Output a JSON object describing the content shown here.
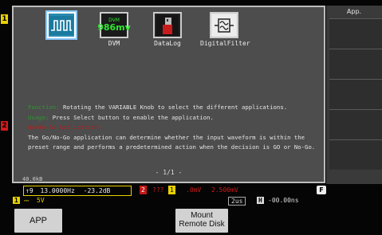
{
  "menu": {
    "title": "App."
  },
  "apps": [
    {
      "id": "go-nogo",
      "label": ""
    },
    {
      "id": "dvm",
      "label": "DVM",
      "screen_top": "DVM",
      "screen_value": "986mv"
    },
    {
      "id": "datalog",
      "label": "DataLog"
    },
    {
      "id": "digitalfilter",
      "label": "DigitalFilter"
    }
  ],
  "description": {
    "line1_label": "Function:",
    "line1_text": "Rotating the VARIABLE Knob to select the different applications.",
    "line2_label": "Usage:",
    "line2_text": "Press Select button to enable the application.",
    "line3_label": "Go/No-Go Application:",
    "body": "The Go/No-Go application can determine whether the input waveform is within the preset range and performs a predetermined action when the decision is GO or No-Go.",
    "page": "- 1/1 -"
  },
  "status": {
    "record": "40.0kB",
    "meas_ch": "↑9",
    "freq": "13.0000Hz",
    "gain": "-23.2dB",
    "ch2_badge": "2",
    "ch2_val": "???",
    "ch1_badge": "1",
    "ch1_val1": ".0mV",
    "ch1_val2": "2.500mV",
    "f_label": "F",
    "ch1_scale": "5V",
    "timebase": "2us",
    "position": "-00.00ns"
  },
  "softkeys": {
    "app": "APP",
    "mount": "Mount",
    "remote": "Remote Disk"
  },
  "colors": {
    "ch1": "#e8d000",
    "ch2": "#d41818",
    "accent_green": "#2a9a2a"
  }
}
